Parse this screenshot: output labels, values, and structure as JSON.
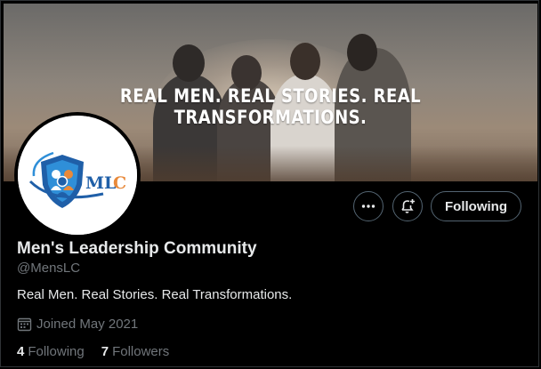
{
  "banner": {
    "tagline": "REAL MEN. REAL STORIES. REAL TRANSFORMATIONS."
  },
  "avatar": {
    "logo_text": "MLC",
    "icon": "mlc-shield-logo"
  },
  "actions": {
    "more_icon": "more-dots-icon",
    "notify_icon": "bell-plus-icon",
    "follow_label": "Following"
  },
  "profile": {
    "name": "Men's Leadership Community",
    "handle": "@MensLC",
    "bio": "Real Men. Real Stories. Real Transformations.",
    "joined": "Joined May 2021",
    "joined_icon": "calendar-icon"
  },
  "stats": {
    "following_count": "4",
    "following_label": "Following",
    "followers_count": "7",
    "followers_label": "Followers"
  },
  "colors": {
    "background": "#000000",
    "text_primary": "#e7e9ea",
    "text_secondary": "#71767b",
    "border": "#536471",
    "logo_blue": "#1f5fa8",
    "logo_orange": "#e8893a"
  }
}
